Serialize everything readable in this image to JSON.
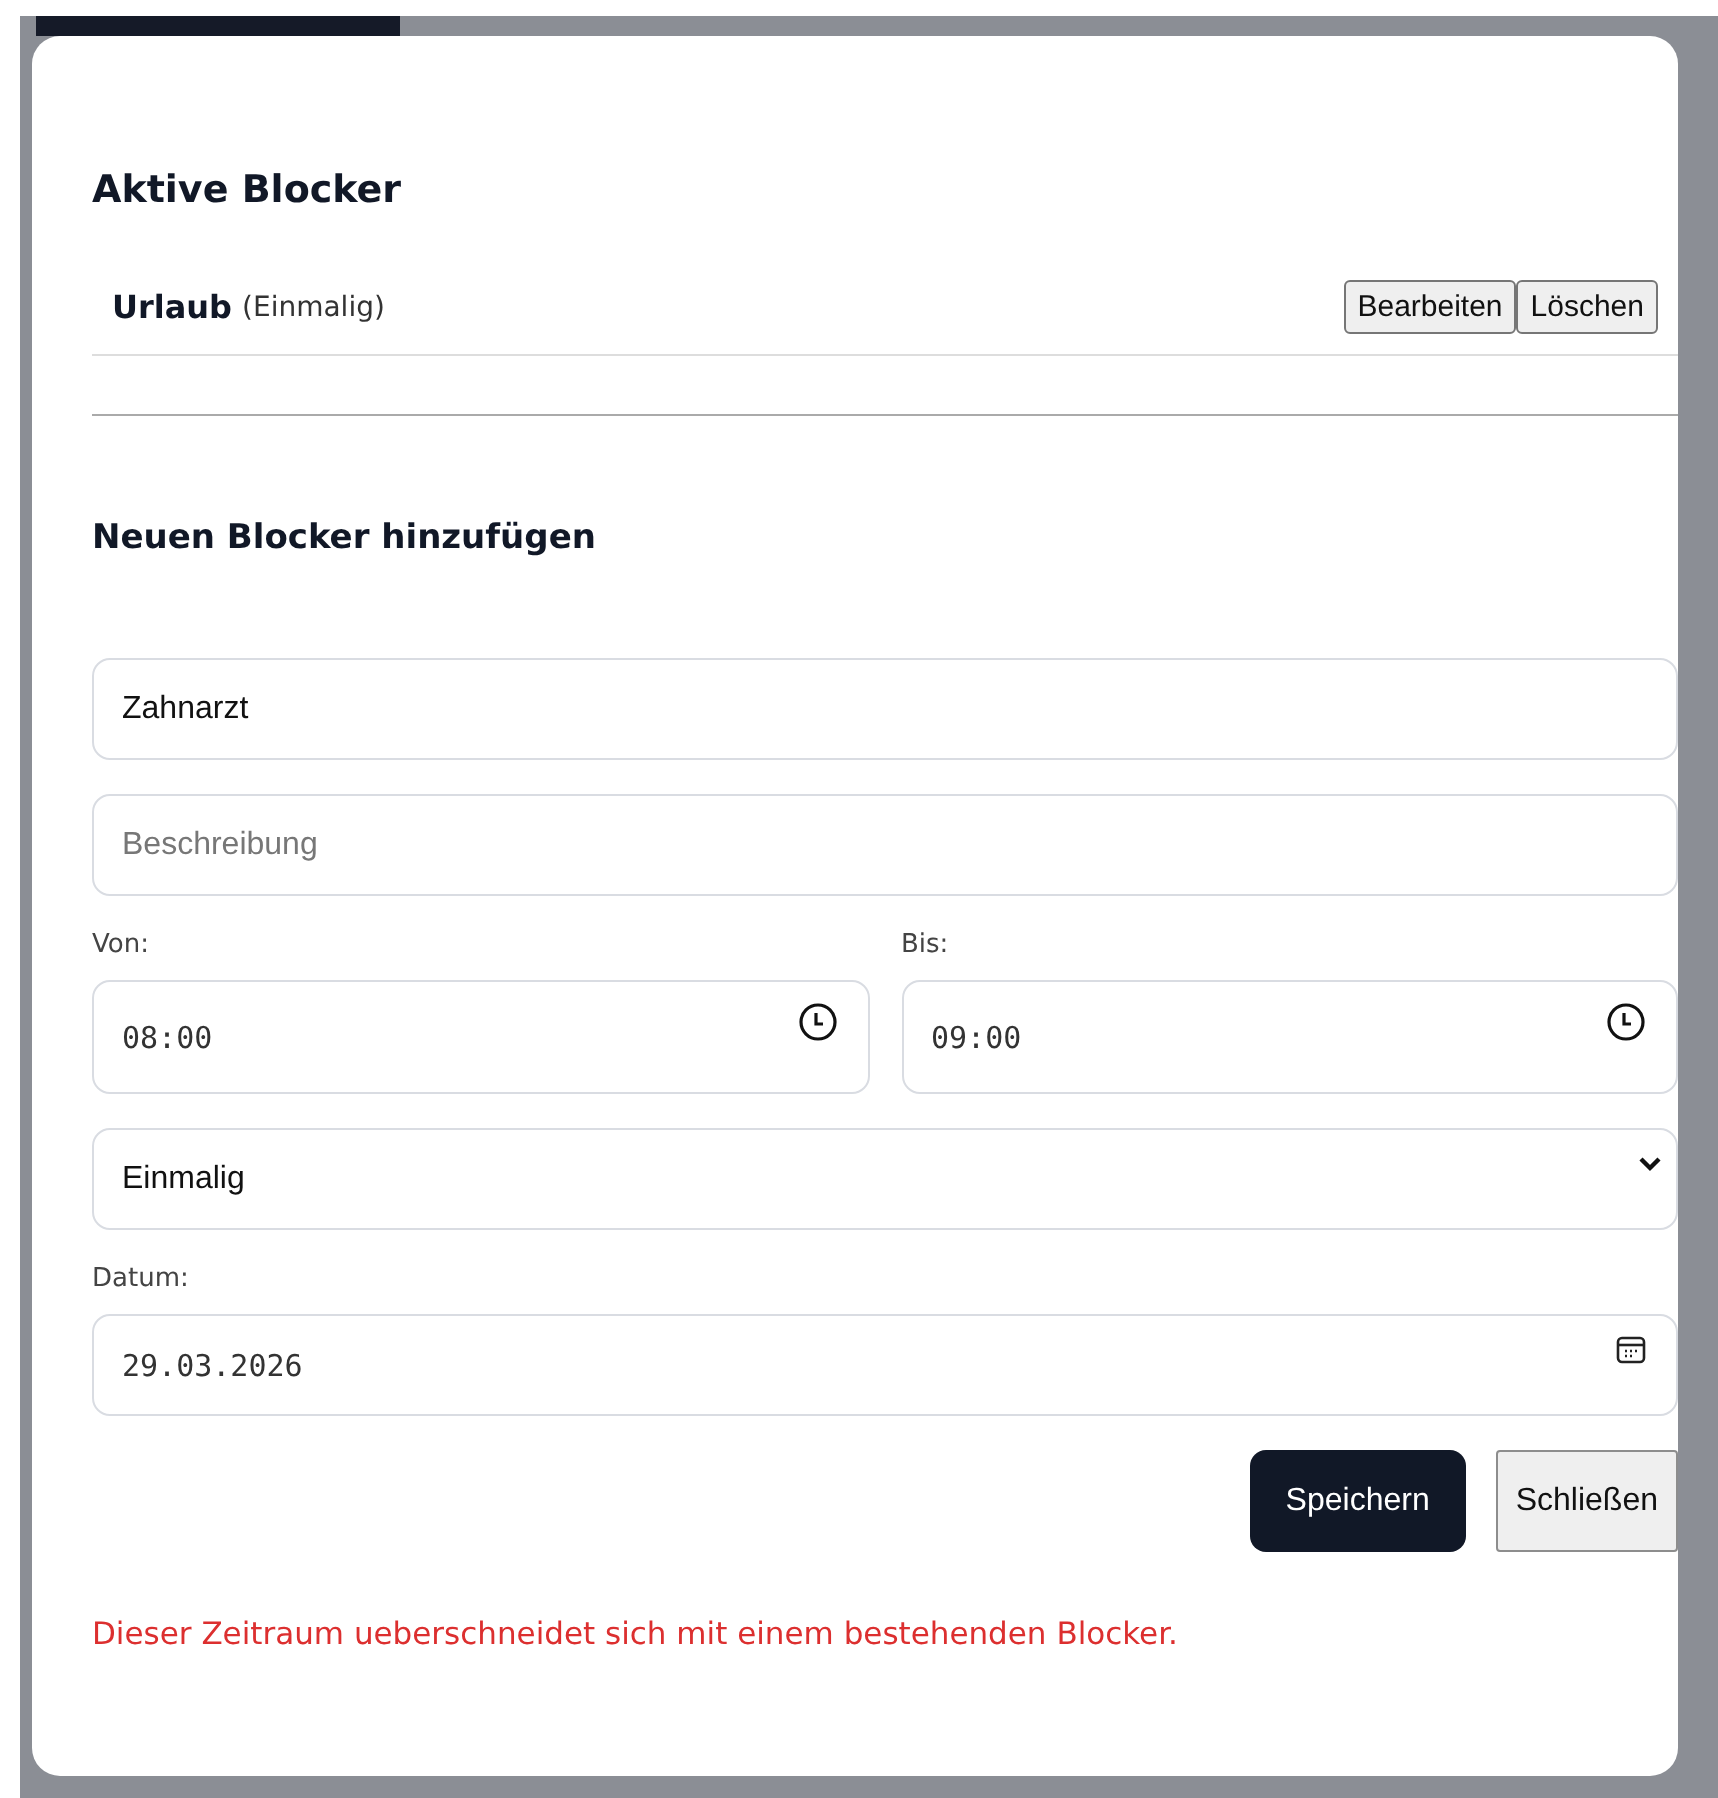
{
  "active_section": {
    "title": "Aktive Blocker",
    "blockers": [
      {
        "name": "Urlaub",
        "recurrence": "(Einmalig)",
        "actions": [
          "Bearbeiten",
          "Löschen"
        ]
      }
    ]
  },
  "new_section": {
    "title": "Neuen Blocker hinzufügen",
    "fields": [
      {
        "kind": "text",
        "value": "Zahnarzt"
      },
      {
        "kind": "text",
        "placeholder": "Beschreibung"
      }
    ],
    "times": [
      {
        "label": "Von:",
        "value": "08:00"
      },
      {
        "label": "Bis:",
        "value": "09:00"
      }
    ],
    "repeat": {
      "value": "Einmalig"
    },
    "date": {
      "label": "Datum:",
      "value": "29.03.2026"
    },
    "buttons": [
      {
        "label": "Speichern",
        "kind": "primary"
      },
      {
        "label": "Schließen",
        "kind": "secondary"
      }
    ],
    "error": "Dieser Zeitraum ueberschneidet sich mit einem bestehenden Blocker."
  }
}
